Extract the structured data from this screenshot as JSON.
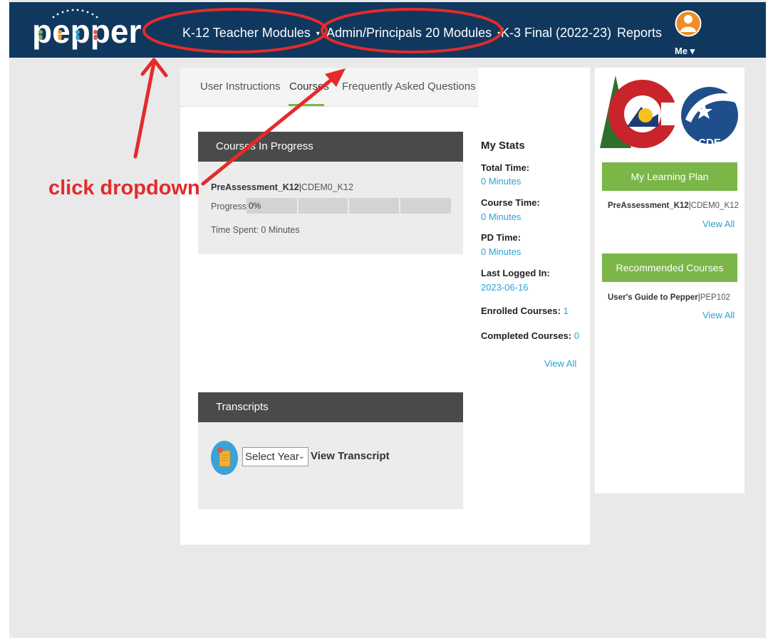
{
  "nav": {
    "brand": "pepper",
    "items": [
      {
        "label": "K-12 Teacher Modules",
        "has_caret": true
      },
      {
        "label": "Admin/Principals 20 Modules",
        "has_caret": true
      },
      {
        "label": "K-3 Final (2022-23)",
        "has_caret": false
      },
      {
        "label": "Reports",
        "has_caret": false
      }
    ],
    "caret": "▾",
    "me_label": "Me ▾"
  },
  "tabs": [
    {
      "label": "User Instructions",
      "active": false
    },
    {
      "label": "Courses",
      "active": true
    },
    {
      "label": "Frequently Asked Questions",
      "active": false
    }
  ],
  "courses_in_progress": {
    "header": "Courses In Progress",
    "course_name": "PreAssessment_K12",
    "separator": "|",
    "course_code": "CDEM0_K12",
    "progress_label": "Progress",
    "progress_value": "0%",
    "progress_fraction": 0,
    "time_spent": "Time Spent: 0 Minutes"
  },
  "stats": {
    "title": "My Stats",
    "total_time_label": "Total Time:",
    "total_time_value": "0 Minutes",
    "course_time_label": "Course Time:",
    "course_time_value": "0 Minutes",
    "pd_time_label": "PD Time:",
    "pd_time_value": "0 Minutes",
    "last_login_label": "Last Logged In:",
    "last_login_value": "2023-06-16",
    "enrolled_label": "Enrolled Courses:",
    "enrolled_value": "1",
    "completed_label": "Completed Courses:",
    "completed_value": "0",
    "view_all": "View All"
  },
  "transcripts": {
    "header": "Transcripts",
    "select_value": "Select Year",
    "view_label": "View Transcript"
  },
  "sidebar": {
    "logo_text": "CDE",
    "learning_plan": {
      "button": "My Learning Plan",
      "course_name": "PreAssessment_K12",
      "separator": "|",
      "course_code": "CDEM0_K12",
      "view_all": "View All"
    },
    "recommended": {
      "button": "Recommended Courses",
      "course_name": "User's Guide to Pepper",
      "separator": "|",
      "course_code": "PEP102",
      "view_all": "View All"
    }
  },
  "annotation": {
    "text": "click dropdown",
    "color": "#e52a2a"
  },
  "colors": {
    "nav_bg": "#10385e",
    "accent_green": "#7ab648",
    "link_blue": "#2aa3d6",
    "panel_header": "#4a4a4a"
  }
}
